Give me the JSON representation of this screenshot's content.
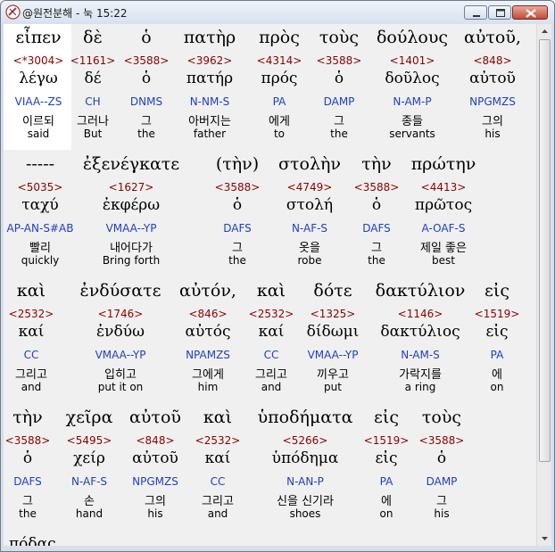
{
  "window": {
    "title": "@원전분해 - 눅 15:22",
    "buttons": {
      "minimize": "minimize",
      "maximize": "maximize",
      "close": "close"
    }
  },
  "rows": [
    {
      "words": [
        {
          "greek": "εἶπεν",
          "strong": "<*3004>",
          "lexeme": "λέγω",
          "parse": "VIAA--ZS",
          "korean": "이르되",
          "english": "said"
        },
        {
          "greek": "δὲ",
          "strong": "<1161>",
          "lexeme": "δέ",
          "parse": "CH",
          "korean": "그러나",
          "english": "But"
        },
        {
          "greek": "ὁ",
          "strong": "<3588>",
          "lexeme": "ὁ",
          "parse": "DNMS",
          "korean": "그",
          "english": "the"
        },
        {
          "greek": "πατὴρ",
          "strong": "<3962>",
          "lexeme": "πατήρ",
          "parse": "N-NM-S",
          "korean": "아버지는",
          "english": "father"
        },
        {
          "greek": "πρὸς",
          "strong": "<4314>",
          "lexeme": "πρός",
          "parse": "PA",
          "korean": "에게",
          "english": "to"
        },
        {
          "greek": "τοὺς",
          "strong": "<3588>",
          "lexeme": "ὁ",
          "parse": "DAMP",
          "korean": "그",
          "english": "the"
        },
        {
          "greek": "δούλους",
          "strong": "<1401>",
          "lexeme": "δοῦλος",
          "parse": "N-AM-P",
          "korean": "종들",
          "english": "servants"
        },
        {
          "greek": "αὐτοῦ,",
          "strong": "<848>",
          "lexeme": "αὐτοῦ",
          "parse": "NPGMZS",
          "korean": "그의",
          "english": "his"
        }
      ]
    },
    {
      "words": [
        {
          "greek": "-----",
          "strong": "<5035>",
          "lexeme": "ταχύ",
          "parse": "AP-AN-S#AB",
          "korean": "빨리",
          "english": "quickly"
        },
        {
          "greek": "ἐξενέγκατε",
          "strong": "<1627>",
          "lexeme": "ἐκφέρω",
          "parse": "VMAA--YP",
          "korean": "내어다가",
          "english": "Bring forth"
        },
        {
          "greek": "(τὴν)",
          "strong": "<3588>",
          "lexeme": "ὁ",
          "parse": "DAFS",
          "korean": "그",
          "english": "the"
        },
        {
          "greek": "στολὴν",
          "strong": "<4749>",
          "lexeme": "στολή",
          "parse": "N-AF-S",
          "korean": "옷을",
          "english": "robe"
        },
        {
          "greek": "τὴν",
          "strong": "<3588>",
          "lexeme": "ὁ",
          "parse": "DAFS",
          "korean": "그",
          "english": "the"
        },
        {
          "greek": "πρώτην",
          "strong": "<4413>",
          "lexeme": "πρῶτος",
          "parse": "A-OAF-S",
          "korean": "제일 좋은",
          "english": "best"
        }
      ]
    },
    {
      "words": [
        {
          "greek": "καὶ",
          "strong": "<2532>",
          "lexeme": "καί",
          "parse": "CC",
          "korean": "그리고",
          "english": "and"
        },
        {
          "greek": "ἐνδύσατε",
          "strong": "<1746>",
          "lexeme": "ἐνδύω",
          "parse": "VMAA--YP",
          "korean": "입히고",
          "english": "put it on"
        },
        {
          "greek": "αὐτόν,",
          "strong": "<846>",
          "lexeme": "αὐτός",
          "parse": "NPAMZS",
          "korean": "그에게",
          "english": "him"
        },
        {
          "greek": "καὶ",
          "strong": "<2532>",
          "lexeme": "καί",
          "parse": "CC",
          "korean": "그리고",
          "english": "and"
        },
        {
          "greek": "δότε",
          "strong": "<1325>",
          "lexeme": "δίδωμι",
          "parse": "VMAA--YP",
          "korean": "끼우고",
          "english": "put"
        },
        {
          "greek": "δακτύλιον",
          "strong": "<1146>",
          "lexeme": "δακτύλιος",
          "parse": "N-AM-S",
          "korean": "가락지를",
          "english": "a ring"
        },
        {
          "greek": "εἰς",
          "strong": "<1519>",
          "lexeme": "εἰς",
          "parse": "PA",
          "korean": "에",
          "english": "on"
        }
      ]
    },
    {
      "words": [
        {
          "greek": "τὴν",
          "strong": "<3588>",
          "lexeme": "ὁ",
          "parse": "DAFS",
          "korean": "그",
          "english": "the"
        },
        {
          "greek": "χεῖρα",
          "strong": "<5495>",
          "lexeme": "χείρ",
          "parse": "N-AF-S",
          "korean": "손",
          "english": "hand"
        },
        {
          "greek": "αὐτοῦ",
          "strong": "<848>",
          "lexeme": "αὐτοῦ",
          "parse": "NPGMZS",
          "korean": "그의",
          "english": "his"
        },
        {
          "greek": "καὶ",
          "strong": "<2532>",
          "lexeme": "καί",
          "parse": "CC",
          "korean": "그리고",
          "english": "and"
        },
        {
          "greek": "ὑποδήματα",
          "strong": "<5266>",
          "lexeme": "ὑπόδημα",
          "parse": "N-AN-P",
          "korean": "신을 신기라",
          "english": "shoes"
        },
        {
          "greek": "εἰς",
          "strong": "<1519>",
          "lexeme": "εἰς",
          "parse": "PA",
          "korean": "에",
          "english": "on"
        },
        {
          "greek": "τοὺς",
          "strong": "<3588>",
          "lexeme": "ὁ",
          "parse": "DAMP",
          "korean": "그",
          "english": "his"
        }
      ]
    }
  ],
  "partial_next": "πόδας"
}
